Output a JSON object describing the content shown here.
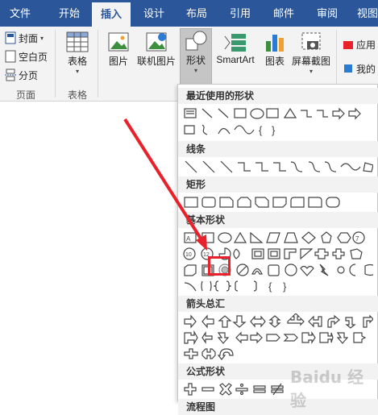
{
  "tabs": [
    "文件",
    "开始",
    "插入",
    "设计",
    "布局",
    "引用",
    "邮件",
    "审阅",
    "视图"
  ],
  "active_tab": "插入",
  "ribbon": {
    "pages": {
      "cover": "封面",
      "blank": "空白页",
      "break": "分页",
      "group": "页面"
    },
    "table": {
      "label": "表格",
      "group": "表格"
    },
    "picture": "图片",
    "online_picture": "联机图片",
    "shapes": "形状",
    "smartart": "SmartArt",
    "chart": "图表",
    "screenshot": "屏幕截图",
    "apps": "应用",
    "my": "我的"
  },
  "gallery": {
    "recent": "最近使用的形状",
    "lines": "线条",
    "rect": "矩形",
    "basic": "基本形状",
    "arrows": "箭头总汇",
    "equation": "公式形状",
    "more": "流程图"
  },
  "watermark": "Baidu 经验",
  "colors": {
    "tabbar": "#2b579a",
    "highlight": "#e8212a"
  }
}
